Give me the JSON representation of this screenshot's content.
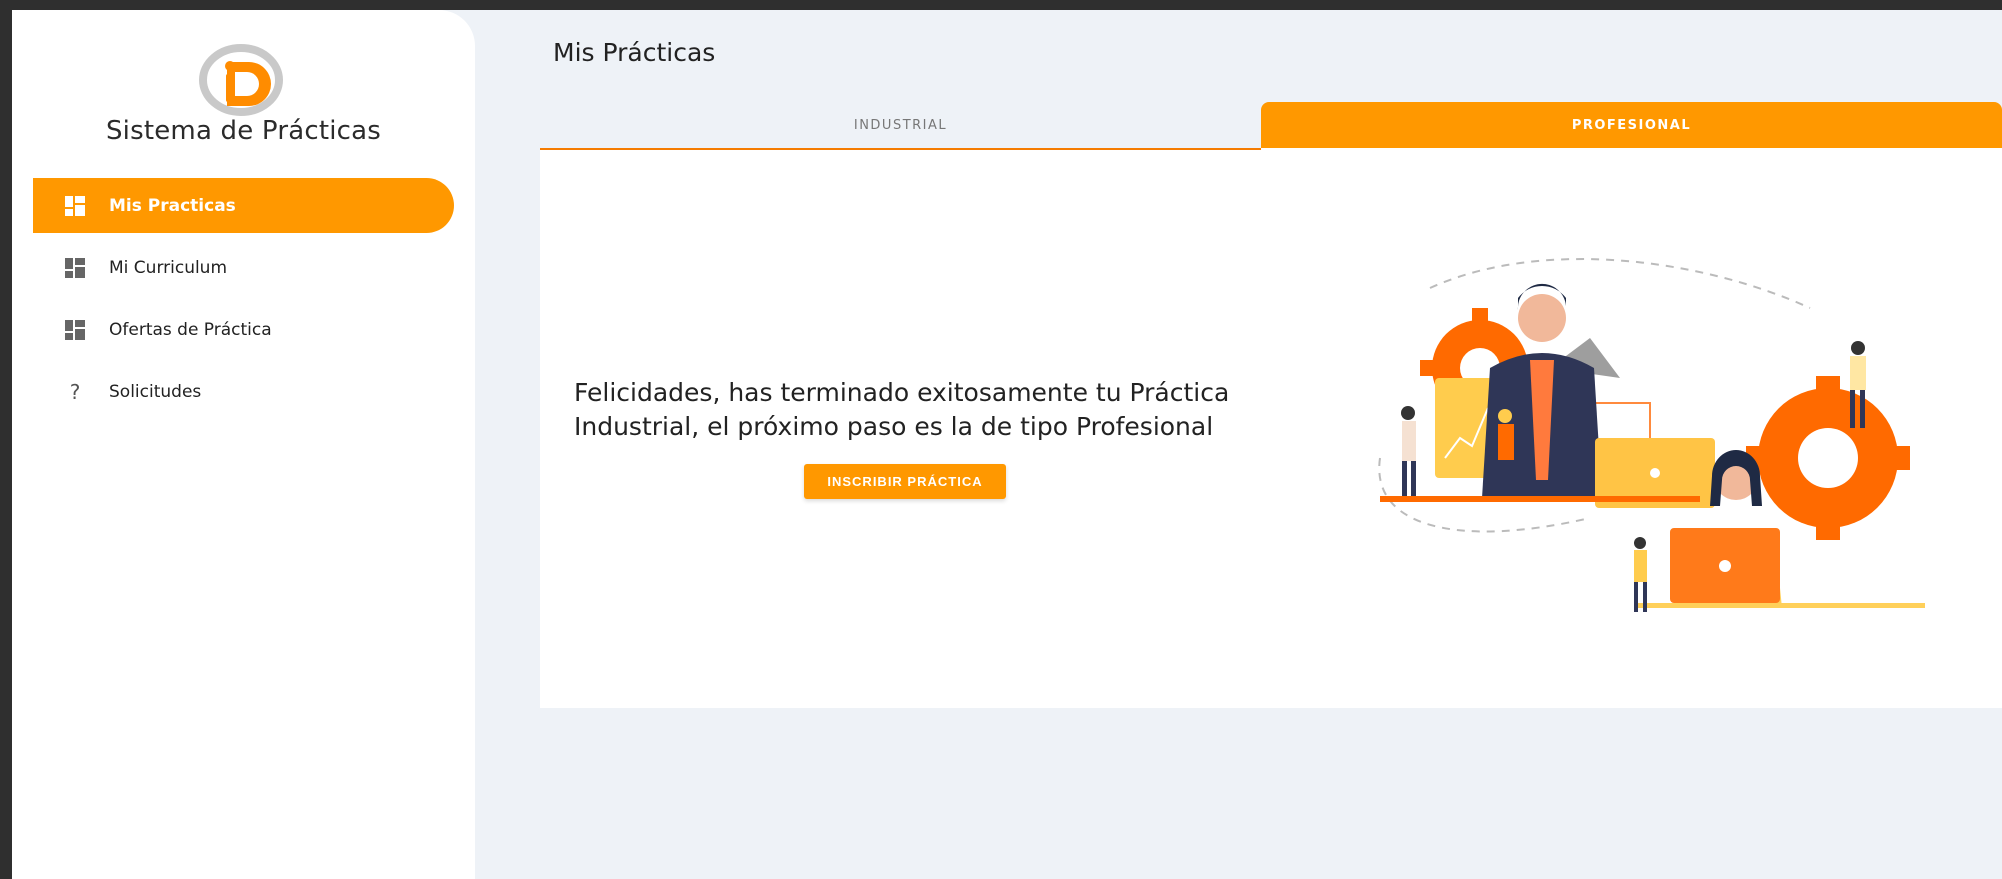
{
  "sidebar": {
    "app_title": "Sistema de Prácticas",
    "items": [
      {
        "label": "Mis Practicas",
        "icon": "dashboard-icon",
        "active": true
      },
      {
        "label": "Mi Curriculum",
        "icon": "dashboard-icon",
        "active": false
      },
      {
        "label": "Ofertas de Práctica",
        "icon": "dashboard-icon",
        "active": false
      },
      {
        "label": "Solicitudes",
        "icon": "question-icon",
        "active": false
      }
    ]
  },
  "main": {
    "page_title": "Mis Prácticas",
    "tabs": [
      {
        "label": "INDUSTRIAL",
        "active": false
      },
      {
        "label": "PROFESIONAL",
        "active": true
      }
    ],
    "message": "Felicidades, has terminado exitosamente tu Práctica Industrial, el próximo paso es la de tipo Profesional",
    "cta_label": "INSCRIBIR PRÁCTICA"
  },
  "colors": {
    "accent": "#ff9800",
    "background": "#eef2f7",
    "sidebar": "#ffffff"
  }
}
